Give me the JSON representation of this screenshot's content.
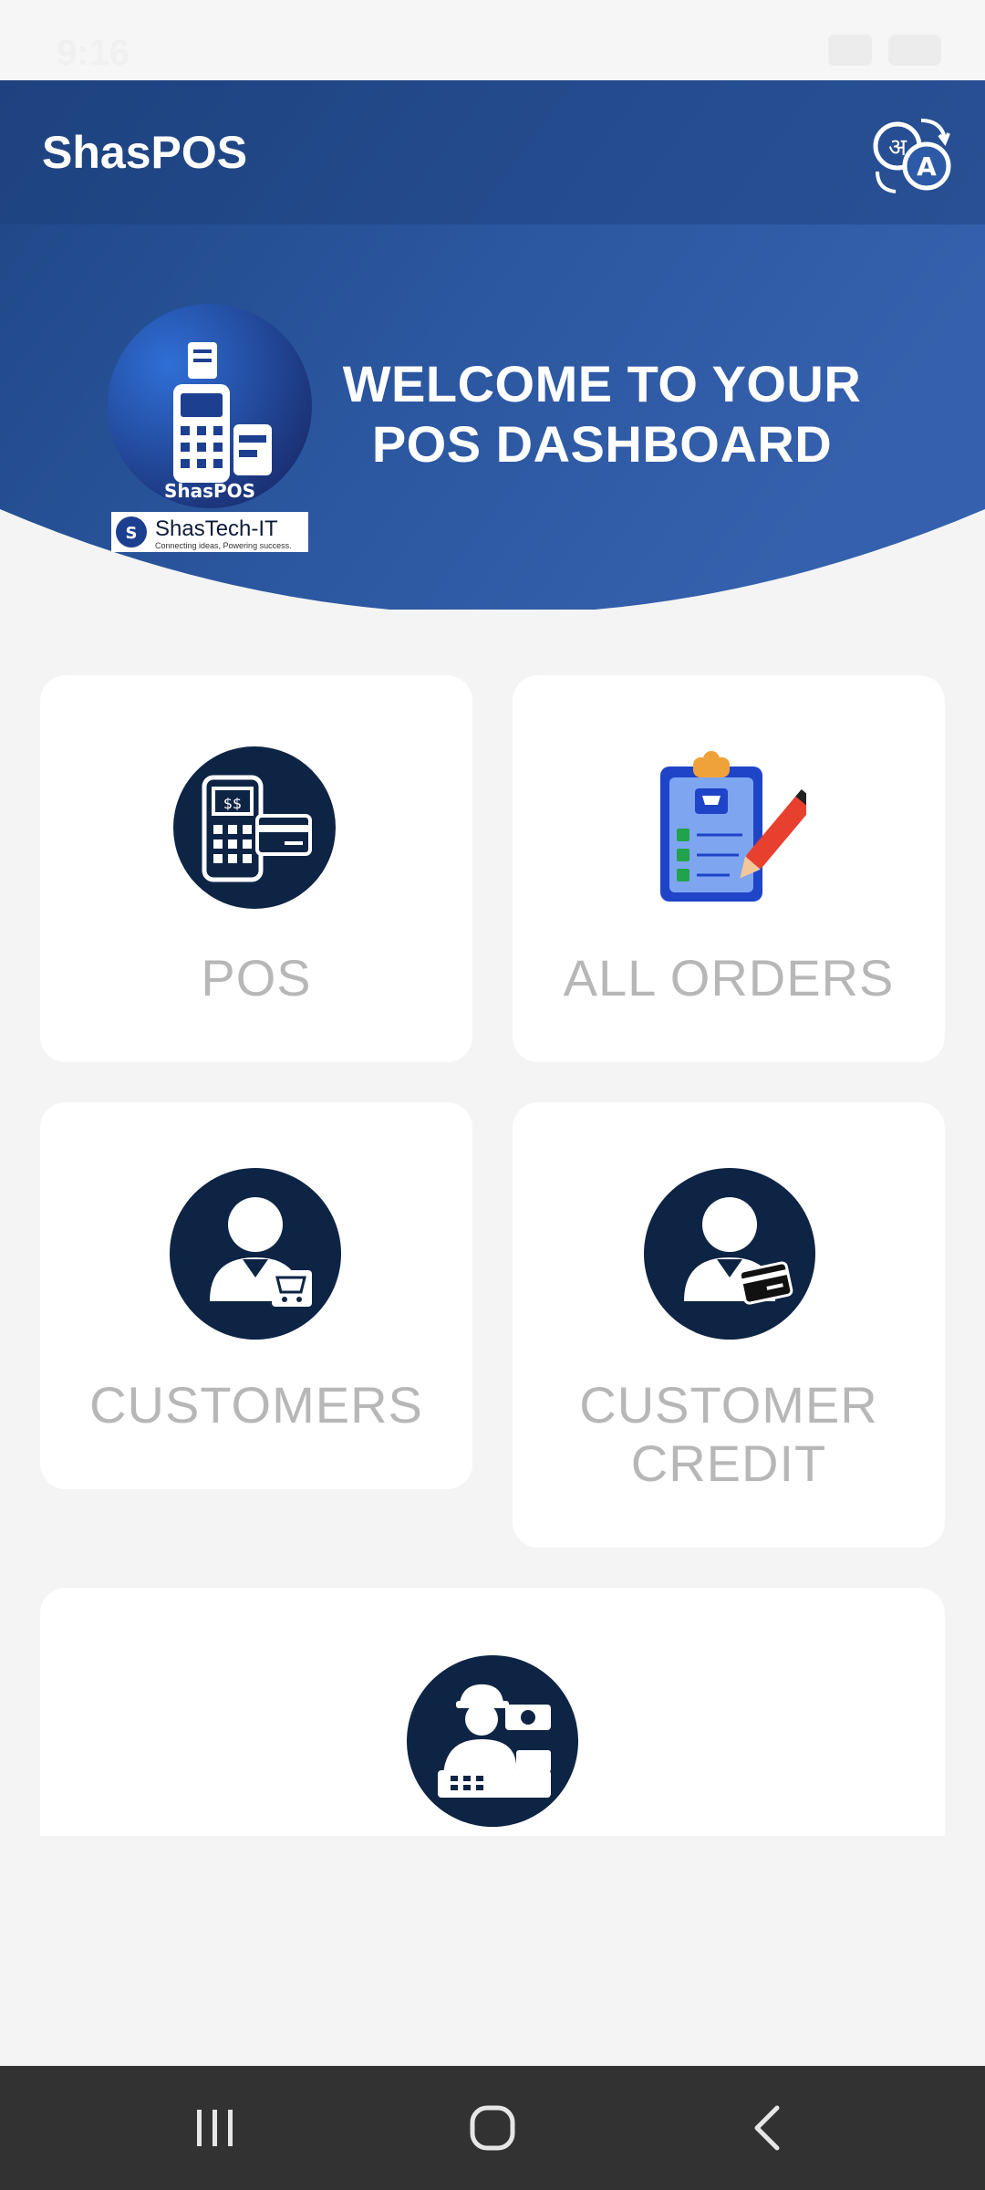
{
  "status": {
    "time": "9:16"
  },
  "header": {
    "app_title": "ShasPOS",
    "welcome_line1": "WELCOME TO YOUR",
    "welcome_line2": "POS DASHBOARD",
    "logo_text": "ShasPOS",
    "brand_text": "ShasTech-IT",
    "brand_tagline": "Connecting ideas, Powering success."
  },
  "tiles": {
    "pos": "POS",
    "all_orders": "ALL ORDERS",
    "customers": "CUSTOMERS",
    "customer_credit_1": "CUSTOMER",
    "customer_credit_2": "CREDIT"
  },
  "icons": {
    "translate": "translate-icon",
    "pos": "pos-terminal-icon",
    "orders": "order-clipboard-icon",
    "customers": "customer-cart-icon",
    "credit": "customer-card-icon",
    "cashier": "cashier-icon",
    "nav_recents": "recents-icon",
    "nav_home": "home-icon",
    "nav_back": "back-icon"
  },
  "colors": {
    "header_blue": "#2d5aa6",
    "icon_navy": "#0e2444",
    "label_gray": "#b7b7b7"
  }
}
